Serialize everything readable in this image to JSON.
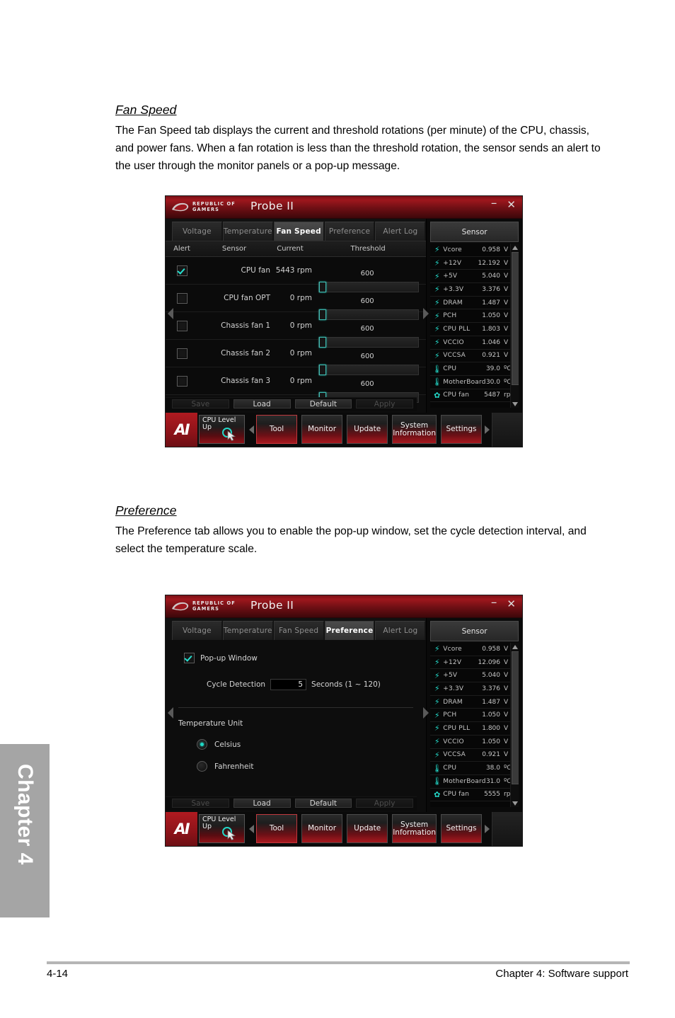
{
  "page": {
    "footer_page_number": "4-14",
    "footer_chapter": "Chapter 4: Software support",
    "side_tab": "Chapter 4"
  },
  "sections": [
    {
      "title": "Fan Speed",
      "body": "The Fan Speed tab displays the current and threshold rotations (per minute) of the CPU, chassis, and power fans. When a fan rotation is less than the threshold rotation, the sensor sends an alert to the user through the monitor panels or a pop-up message."
    },
    {
      "title": "Preference",
      "body": "The Preference tab allows you to enable the pop-up window, set the cycle detection interval, and select the temperature scale."
    }
  ],
  "app": {
    "brand_line1": "REPUBLIC OF",
    "brand_line2": "GAMERS",
    "title": "Probe II",
    "minimize": "–",
    "close": "✕",
    "tabs": [
      "Voltage",
      "Temperature",
      "Fan Speed",
      "Preference",
      "Alert Log"
    ],
    "sensor_header": "Sensor",
    "actions": [
      "Save",
      "Load",
      "Default",
      "Apply"
    ],
    "launcher": {
      "logo": "AI",
      "cpu_level_up": "CPU Level Up",
      "buttons": [
        "Tool",
        "Monitor",
        "Update",
        "System Information",
        "Settings"
      ]
    }
  },
  "fan_speed_window": {
    "active_tab": "Fan Speed",
    "columns": [
      "Alert",
      "Sensor",
      "Current",
      "Threshold"
    ],
    "rows": [
      {
        "alert": true,
        "sensor": "CPU fan",
        "current": "5443 rpm",
        "threshold": "600"
      },
      {
        "alert": false,
        "sensor": "CPU fan OPT",
        "current": "0 rpm",
        "threshold": "600"
      },
      {
        "alert": false,
        "sensor": "Chassis fan 1",
        "current": "0 rpm",
        "threshold": "600"
      },
      {
        "alert": false,
        "sensor": "Chassis fan 2",
        "current": "0 rpm",
        "threshold": "600"
      },
      {
        "alert": false,
        "sensor": "Chassis fan 3",
        "current": "0 rpm",
        "threshold": "600"
      }
    ],
    "sensors": [
      {
        "icon": "bolt-icon",
        "name": "Vcore",
        "value": "0.958",
        "unit": "V"
      },
      {
        "icon": "bolt-icon",
        "name": "+12V",
        "value": "12.192",
        "unit": "V"
      },
      {
        "icon": "bolt-icon",
        "name": "+5V",
        "value": "5.040",
        "unit": "V"
      },
      {
        "icon": "bolt-icon",
        "name": "+3.3V",
        "value": "3.376",
        "unit": "V"
      },
      {
        "icon": "bolt-icon",
        "name": "DRAM",
        "value": "1.487",
        "unit": "V"
      },
      {
        "icon": "bolt-icon",
        "name": "PCH",
        "value": "1.050",
        "unit": "V"
      },
      {
        "icon": "bolt-icon",
        "name": "CPU PLL",
        "value": "1.803",
        "unit": "V"
      },
      {
        "icon": "bolt-icon",
        "name": "VCCIO",
        "value": "1.046",
        "unit": "V"
      },
      {
        "icon": "bolt-icon",
        "name": "VCCSA",
        "value": "0.921",
        "unit": "V"
      },
      {
        "icon": "thermometer-icon",
        "name": "CPU",
        "value": "39.0",
        "unit": "ºC"
      },
      {
        "icon": "thermometer-icon",
        "name": "MotherBoard",
        "value": "30.0",
        "unit": "ºC"
      },
      {
        "icon": "fan-icon",
        "name": "CPU fan",
        "value": "5487",
        "unit": "rpm"
      }
    ]
  },
  "preference_window": {
    "active_tab": "Preference",
    "popup_window_label": "Pop-up Window",
    "popup_window_checked": true,
    "cycle_detection_label": "Cycle Detection",
    "cycle_detection_value": "5",
    "cycle_detection_suffix": "Seconds (1 ~ 120)",
    "temperature_unit_label": "Temperature Unit",
    "temperature_options": [
      "Celsius",
      "Fahrenheit"
    ],
    "temperature_selected": "Celsius",
    "sensors": [
      {
        "icon": "bolt-icon",
        "name": "Vcore",
        "value": "0.958",
        "unit": "V"
      },
      {
        "icon": "bolt-icon",
        "name": "+12V",
        "value": "12.096",
        "unit": "V"
      },
      {
        "icon": "bolt-icon",
        "name": "+5V",
        "value": "5.040",
        "unit": "V"
      },
      {
        "icon": "bolt-icon",
        "name": "+3.3V",
        "value": "3.376",
        "unit": "V"
      },
      {
        "icon": "bolt-icon",
        "name": "DRAM",
        "value": "1.487",
        "unit": "V"
      },
      {
        "icon": "bolt-icon",
        "name": "PCH",
        "value": "1.050",
        "unit": "V"
      },
      {
        "icon": "bolt-icon",
        "name": "CPU PLL",
        "value": "1.800",
        "unit": "V"
      },
      {
        "icon": "bolt-icon",
        "name": "VCCIO",
        "value": "1.050",
        "unit": "V"
      },
      {
        "icon": "bolt-icon",
        "name": "VCCSA",
        "value": "0.921",
        "unit": "V"
      },
      {
        "icon": "thermometer-icon",
        "name": "CPU",
        "value": "38.0",
        "unit": "ºC"
      },
      {
        "icon": "thermometer-icon",
        "name": "MotherBoard",
        "value": "31.0",
        "unit": "ºC"
      },
      {
        "icon": "fan-icon",
        "name": "CPU fan",
        "value": "5555",
        "unit": "rpm"
      }
    ]
  },
  "colors": {
    "accent_teal": "#23d8c8",
    "rog_red": "#9e171d",
    "tab_active": "#4b4b4b"
  }
}
